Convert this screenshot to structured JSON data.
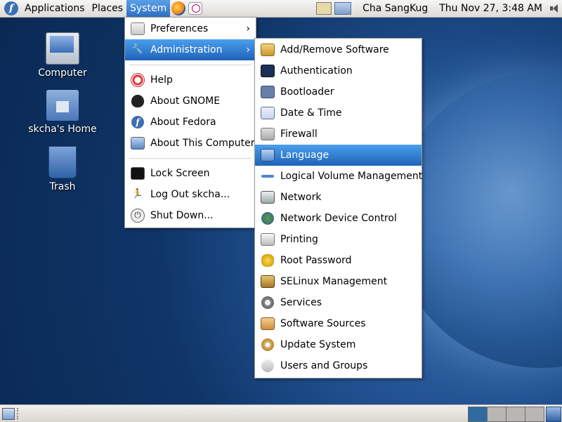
{
  "top_panel": {
    "menus": [
      "Applications",
      "Places",
      "System"
    ],
    "active_menu": "System",
    "user": "Cha SangKug",
    "clock": "Thu Nov 27,  3:48 AM"
  },
  "desktop": {
    "icons": [
      {
        "label": "Computer"
      },
      {
        "label": "skcha's Home"
      },
      {
        "label": "Trash"
      }
    ]
  },
  "system_menu": {
    "items": [
      {
        "label": "Preferences",
        "icon": "preferences-icon",
        "submenu": true
      },
      {
        "label": "Administration",
        "icon": "administration-icon",
        "submenu": true,
        "highlighted": true
      },
      {
        "label": "Help",
        "icon": "help-icon"
      },
      {
        "label": "About GNOME",
        "icon": "gnome-icon"
      },
      {
        "label": "About Fedora",
        "icon": "fedora-icon"
      },
      {
        "label": "About This Computer",
        "icon": "computer-icon"
      },
      {
        "label": "Lock Screen",
        "icon": "lock-icon"
      },
      {
        "label": "Log Out skcha...",
        "icon": "logout-icon"
      },
      {
        "label": "Shut Down...",
        "icon": "shutdown-icon"
      }
    ]
  },
  "admin_menu": {
    "items": [
      {
        "label": "Add/Remove Software"
      },
      {
        "label": "Authentication"
      },
      {
        "label": "Bootloader"
      },
      {
        "label": "Date & Time"
      },
      {
        "label": "Firewall"
      },
      {
        "label": "Language",
        "highlighted": true
      },
      {
        "label": "Logical Volume Management"
      },
      {
        "label": "Network"
      },
      {
        "label": "Network Device Control"
      },
      {
        "label": "Printing"
      },
      {
        "label": "Root Password"
      },
      {
        "label": "SELinux Management"
      },
      {
        "label": "Services"
      },
      {
        "label": "Software Sources"
      },
      {
        "label": "Update System"
      },
      {
        "label": "Users and Groups"
      }
    ]
  },
  "bottom_panel": {
    "workspaces": 4,
    "active_workspace": 1
  },
  "colors": {
    "highlight": "#2f78d0",
    "desktop_bg": "#1a4b88"
  }
}
